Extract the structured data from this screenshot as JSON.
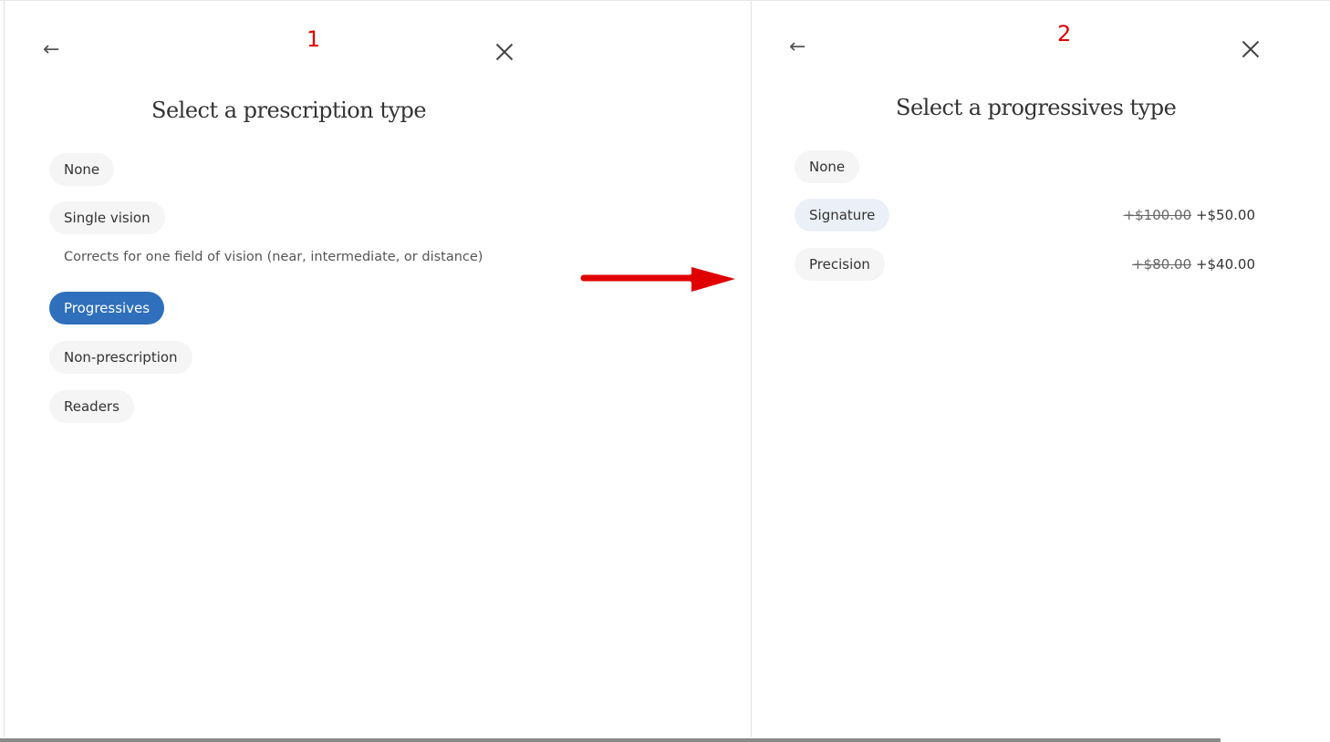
{
  "annotations": {
    "step1": "1",
    "step2": "2",
    "arrow_color": "#e00000"
  },
  "panel1": {
    "title": "Select a prescription type",
    "options": [
      {
        "label": "None"
      },
      {
        "label": "Single vision",
        "description": "Corrects for one field of vision (near, intermediate, or distance)"
      },
      {
        "label": "Progressives",
        "selected": true
      },
      {
        "label": "Non-prescription"
      },
      {
        "label": "Readers"
      }
    ]
  },
  "panel2": {
    "title": "Select a progressives type",
    "options": [
      {
        "label": "None"
      },
      {
        "label": "Signature",
        "original_price": "+$100.00",
        "price": "+$50.00",
        "highlighted": true
      },
      {
        "label": "Precision",
        "original_price": "+$80.00",
        "price": "+$40.00"
      }
    ]
  },
  "colors": {
    "accent": "#2f6fbc",
    "pill": "#f5f5f5",
    "hover": "#ebf0f8"
  }
}
